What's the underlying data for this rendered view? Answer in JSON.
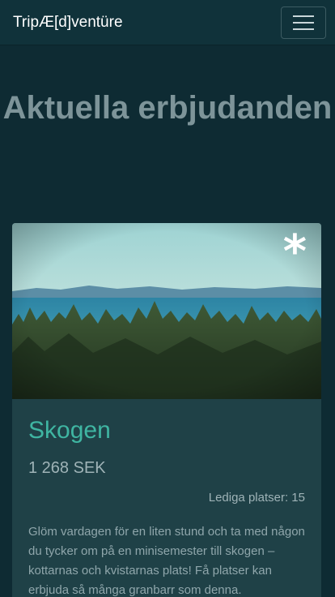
{
  "navbar": {
    "brand": "TripÆ[d]ventüre",
    "menu_icon": "hamburger-menu-icon"
  },
  "hero": {
    "title": "Aktuella erbjudanden"
  },
  "offer": {
    "badge_icon": "asterisk-icon",
    "title": "Skogen",
    "price": "1 268 SEK",
    "seats": "Lediga platser: 15",
    "description": "Glöm vardagen för en liten stund och ta med någon du tycker om på en minisemester till skogen – kottarnas och kvistarnas plats! Få platser kan erbjuda så många granbarr som denna."
  },
  "colors": {
    "background": "#0e2b33",
    "navbar": "#10323a",
    "card": "#1f4147",
    "accent": "#3fb5a2"
  }
}
